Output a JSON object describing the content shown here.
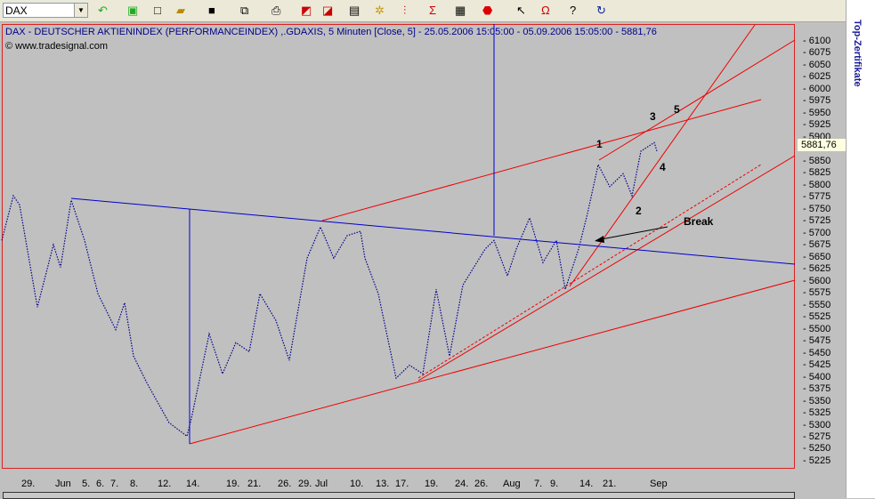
{
  "toolbar": {
    "symbol": "DAX",
    "icons": [
      "refresh-icon",
      "update-icon",
      "new-icon",
      "open-icon",
      "save-icon",
      "copy-icon",
      "print-icon",
      "back-icon",
      "forward-icon",
      "window-icon",
      "indicator-icon",
      "drawing-icon",
      "sigma-icon",
      "properties-icon",
      "stop-icon",
      "cursor-icon",
      "magnet-icon",
      "help-icon",
      "undo-icon"
    ]
  },
  "chart": {
    "title": "DAX  - DEUTSCHER AKTIENINDEX (PERFORMANCEINDEX) ,.GDAXIS, 5 Minuten [Close, 5] - 25.05.2006 15:05:00 - 05.09.2006 15:05:00 - 5881,76",
    "copyright": "© www.tradesignal.com",
    "current_price": "5881,76",
    "annotations": [
      "1",
      "2",
      "3",
      "4",
      "5",
      "Break"
    ]
  },
  "sidebar": {
    "label": "Top-Zertifikate"
  },
  "chart_data": {
    "type": "line",
    "ylim": [
      5225,
      6110
    ],
    "yticks": [
      "6100",
      "6075",
      "6050",
      "6025",
      "6000",
      "5975",
      "5950",
      "5925",
      "5900",
      "5875",
      "5850",
      "5825",
      "5800",
      "5775",
      "5750",
      "5725",
      "5700",
      "5675",
      "5650",
      "5625",
      "5600",
      "5575",
      "5550",
      "5525",
      "5500",
      "5475",
      "5450",
      "5425",
      "5400",
      "5375",
      "5350",
      "5325",
      "5300",
      "5275",
      "5250",
      "5225"
    ],
    "xticks": [
      "29.",
      "Jun",
      "5.",
      "6.",
      "7.",
      "8.",
      "12.",
      "14.",
      "19.",
      "21.",
      "26.",
      "29.",
      "Jul",
      "10.",
      "13.",
      "17.",
      "19.",
      "24.",
      "26.",
      "Aug",
      "7.",
      "9.",
      "14.",
      "21.",
      "Sep"
    ],
    "series": [
      {
        "name": "DAX",
        "values": [
          5686,
          5779,
          5760,
          5547,
          5677,
          5630,
          5770,
          5686,
          5575,
          5500,
          5556,
          5445,
          5389,
          5306,
          5278,
          5315,
          5491,
          5408,
          5473,
          5454,
          5575,
          5519,
          5436,
          5649,
          5714,
          5649,
          5696,
          5705,
          5649,
          5575,
          5399,
          5426,
          5408,
          5584,
          5445,
          5593,
          5668,
          5686,
          5612,
          5668,
          5733,
          5640,
          5686,
          5584,
          5668,
          5742,
          5844,
          5798,
          5825,
          5779,
          5872,
          5890,
          5872
        ]
      }
    ]
  }
}
